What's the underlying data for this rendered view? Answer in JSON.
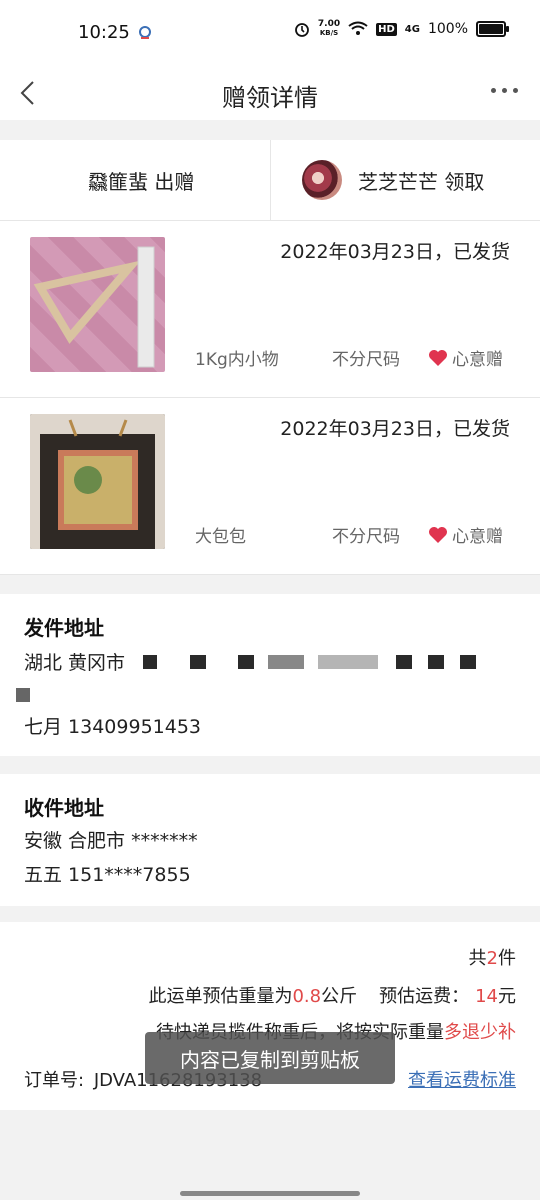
{
  "status_bar": {
    "time": "10:25",
    "speed_value": "7.00",
    "speed_unit": "KB/S",
    "hd": "HD",
    "network": "4G",
    "battery": "100%"
  },
  "nav": {
    "title": "赠领详情"
  },
  "parties": {
    "giver": "飝篚蜚 出赠",
    "receiver": "芝芝芒芒 领取"
  },
  "items": [
    {
      "date_status": "2022年03月23日，已发货",
      "description": "1Kg内小物",
      "size": "不分尺码",
      "gift_type": "心意赠"
    },
    {
      "date_status": "2022年03月23日，已发货",
      "description": "大包包",
      "size": "不分尺码",
      "gift_type": "心意赠"
    }
  ],
  "sender": {
    "label": "发件地址",
    "region": "湖北 黄冈市",
    "contact": "七月 13409951453"
  },
  "receiver": {
    "label": "收件地址",
    "address": "安徽 合肥市 *******",
    "contact": "五五 151****7855"
  },
  "summary": {
    "count_prefix": "共",
    "count": "2",
    "count_suffix": "件",
    "weight_prefix": "此运单预估重量为",
    "weight_value": "0.8",
    "weight_unit": "公斤",
    "fee_label": "预估运费：",
    "fee_value": "14",
    "fee_unit": "元",
    "note_prefix": "待快递员揽件称重后，将按实际重量",
    "note_highlight": "多退少补",
    "order_label": "订单号:",
    "order_number": "JDVA11628193138",
    "fee_standard_link": "查看运费标准"
  },
  "toast": "内容已复制到剪贴板",
  "colors": {
    "accent_red": "#e04a4a",
    "link_blue": "#3b6fb6",
    "heart": "#e0344f"
  }
}
